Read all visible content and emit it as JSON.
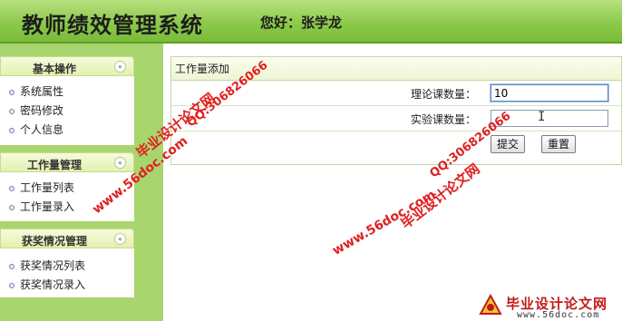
{
  "header": {
    "title": "教师绩效管理系统",
    "greeting": "您好：张学龙"
  },
  "sidebar": {
    "groups": [
      {
        "label": "基本操作",
        "items": [
          "系统属性",
          "密码修改",
          "个人信息"
        ]
      },
      {
        "label": "工作量管理",
        "items": [
          "工作量列表",
          "工作量录入"
        ]
      },
      {
        "label": "获奖情况管理",
        "items": [
          "获奖情况列表",
          "获奖情况录入"
        ]
      }
    ],
    "collapse_icon_text": "«"
  },
  "form": {
    "title": "工作量添加",
    "theory_label": "理论课数量：",
    "theory_value": "10",
    "lab_label": "实验课数量：",
    "lab_value": "",
    "submit_label": "提交",
    "reset_label": "重置"
  },
  "watermark": {
    "site_name": "毕业设计论文网",
    "qq": "QQ:306826066",
    "url": "www.56doc.com",
    "logo_url": "www.56doc.com",
    "color": "#e02020"
  }
}
